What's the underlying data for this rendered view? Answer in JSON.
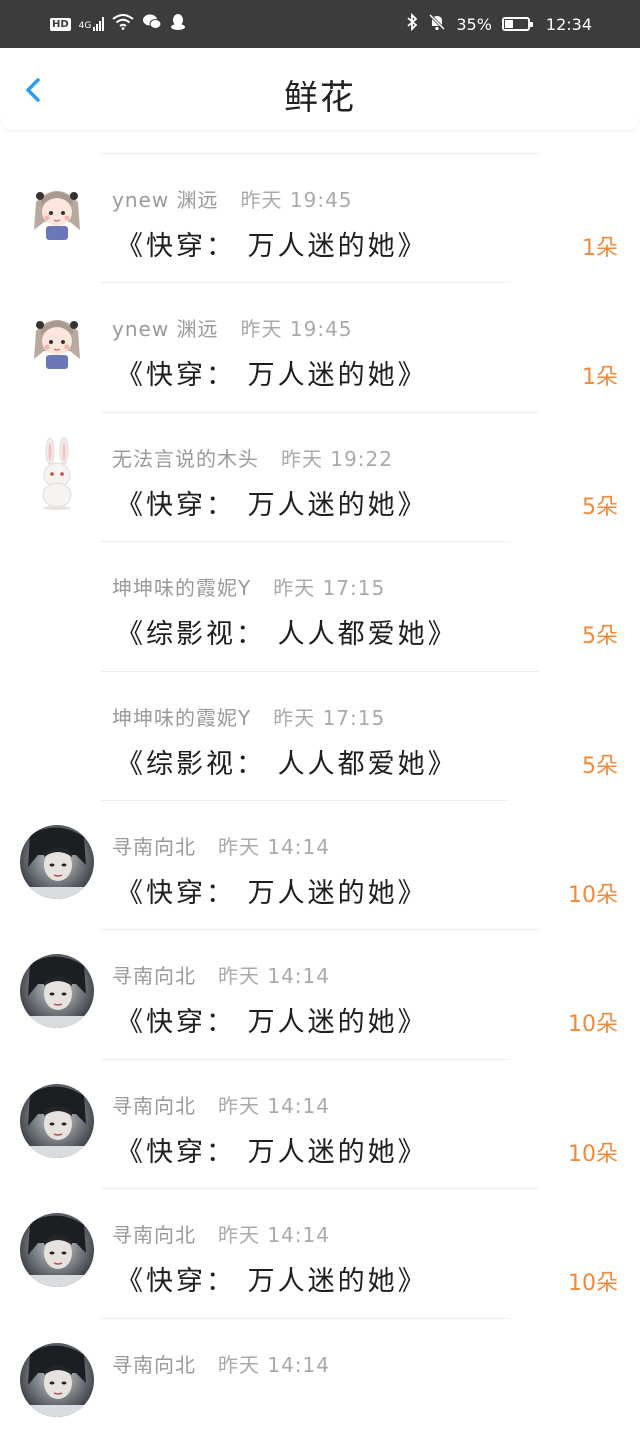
{
  "status_bar": {
    "hd": "HD",
    "network": "4G",
    "battery_percent": "35%",
    "battery_level": 0.35,
    "time": "12:34",
    "icons": [
      "signal-icon",
      "wifi-icon",
      "wechat-icon",
      "qq-icon",
      "bluetooth-icon",
      "mute-icon",
      "battery-icon"
    ]
  },
  "header": {
    "title": "鲜花",
    "back_icon": "chevron-left-icon"
  },
  "colors": {
    "accent": "#2a9df4",
    "count": "#f08a3a",
    "status_bar_bg": "#3c3c3c"
  },
  "records": [
    {
      "user": "ynew 渊远",
      "time": "昨天 19:45",
      "book": "《快穿： 万人迷的她》",
      "count": "1朵",
      "avatar": "anime-girl"
    },
    {
      "user": "ynew 渊远",
      "time": "昨天 19:45",
      "book": "《快穿： 万人迷的她》",
      "count": "1朵",
      "avatar": "anime-girl"
    },
    {
      "user": "无法言说的木头",
      "time": "昨天 19:22",
      "book": "《快穿： 万人迷的她》",
      "count": "5朵",
      "avatar": "rabbit"
    },
    {
      "user": "坤坤味的霞妮Y",
      "time": "昨天 17:15",
      "book": "《综影视： 人人都爱她》",
      "count": "5朵",
      "avatar": "none"
    },
    {
      "user": "坤坤味的霞妮Y",
      "time": "昨天 17:15",
      "book": "《综影视： 人人都爱她》",
      "count": "5朵",
      "avatar": "none"
    },
    {
      "user": "寻南向北",
      "time": "昨天 14:14",
      "book": "《快穿： 万人迷的她》",
      "count": "10朵",
      "avatar": "photo"
    },
    {
      "user": "寻南向北",
      "time": "昨天 14:14",
      "book": "《快穿： 万人迷的她》",
      "count": "10朵",
      "avatar": "photo"
    },
    {
      "user": "寻南向北",
      "time": "昨天 14:14",
      "book": "《快穿： 万人迷的她》",
      "count": "10朵",
      "avatar": "photo"
    },
    {
      "user": "寻南向北",
      "time": "昨天 14:14",
      "book": "《快穿： 万人迷的她》",
      "count": "10朵",
      "avatar": "photo"
    },
    {
      "user": "寻南向北",
      "time": "昨天 14:14",
      "book": "",
      "count": "",
      "avatar": "photo"
    }
  ]
}
